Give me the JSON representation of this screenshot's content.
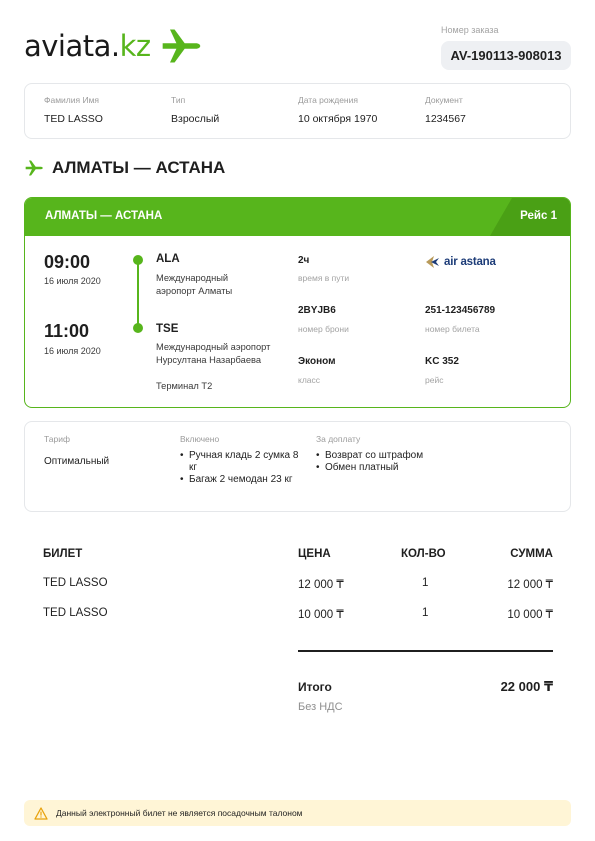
{
  "logo": {
    "text_main": "aviata.",
    "text_accent": "kz"
  },
  "order": {
    "label": "Номер заказа",
    "number": "AV-190113-908013"
  },
  "passenger": {
    "name_label": "Фамилия Имя",
    "name": "TED LASSO",
    "type_label": "Тип",
    "type": "Взрослый",
    "dob_label": "Дата рождения",
    "dob": "10 октября 1970",
    "doc_label": "Документ",
    "doc": "1234567"
  },
  "route_title": "АЛМАТЫ — АСТАНА",
  "flight": {
    "header_title": "АЛМАТЫ — АСТАНА",
    "flight_no": "Рейс 1",
    "departure": {
      "time": "09:00",
      "date": "16 июля 2020",
      "code": "ALA",
      "airport": "Международный аэропорт Алматы"
    },
    "arrival": {
      "time": "11:00",
      "date": "16 июля 2020",
      "code": "TSE",
      "airport": "Международный аэропорт Нурсултана Назарбаева",
      "terminal": "Терминал Т2"
    },
    "duration": "2ч",
    "duration_label": "время в пути",
    "booking": "2BYJB6",
    "booking_label": "номер брони",
    "ticket": "251-123456789",
    "ticket_label": "номер билета",
    "class": "Эконом",
    "class_label": "класс",
    "trip": "KC 352",
    "trip_label": "рейс",
    "airline": "air astana"
  },
  "tariff": {
    "tariff_label": "Тариф",
    "tariff_value": "Оптимальный",
    "included_label": "Включено",
    "included": [
      "Ручная кладь 2 сумка 8 кг",
      "Багаж 2 чемодан 23 кг"
    ],
    "extra_label": "За доплату",
    "extra": [
      "Возврат со штрафом",
      "Обмен платный"
    ]
  },
  "table": {
    "headers": {
      "ticket": "БИЛЕТ",
      "price": "ЦЕНА",
      "qty": "КОЛ-ВО",
      "sum": "СУММА"
    },
    "rows": [
      {
        "name": "TED LASSO",
        "price": "12 000 ₸",
        "qty": "1",
        "sum": "12 000 ₸"
      },
      {
        "name": "TED LASSO",
        "price": "10 000 ₸",
        "qty": "1",
        "sum": "10 000 ₸"
      }
    ],
    "total_label": "Итого",
    "total_value": "22 000 ₸",
    "vat_note": "Без НДС"
  },
  "warning": "Данный электронный билет не является посадочным талоном",
  "colors": {
    "accent": "#57b51c",
    "accent_dark": "#4aa015",
    "warning_bg": "#fff5d6"
  },
  "icons": {
    "logo": "plane-icon",
    "route": "plane-icon",
    "warning": "warning-icon",
    "airline": "air-astana-logo"
  }
}
